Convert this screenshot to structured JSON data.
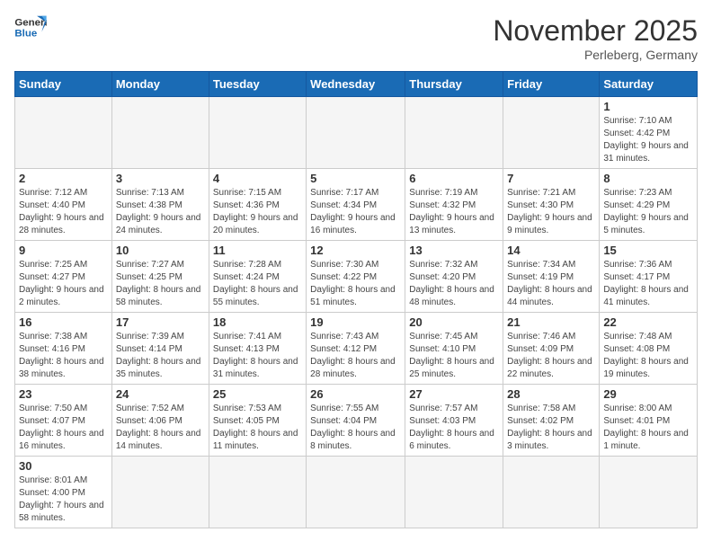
{
  "header": {
    "logo_general": "General",
    "logo_blue": "Blue",
    "month_title": "November 2025",
    "subtitle": "Perleberg, Germany"
  },
  "days_of_week": [
    "Sunday",
    "Monday",
    "Tuesday",
    "Wednesday",
    "Thursday",
    "Friday",
    "Saturday"
  ],
  "weeks": [
    [
      {
        "day": "",
        "info": ""
      },
      {
        "day": "",
        "info": ""
      },
      {
        "day": "",
        "info": ""
      },
      {
        "day": "",
        "info": ""
      },
      {
        "day": "",
        "info": ""
      },
      {
        "day": "",
        "info": ""
      },
      {
        "day": "1",
        "info": "Sunrise: 7:10 AM\nSunset: 4:42 PM\nDaylight: 9 hours\nand 31 minutes."
      }
    ],
    [
      {
        "day": "2",
        "info": "Sunrise: 7:12 AM\nSunset: 4:40 PM\nDaylight: 9 hours\nand 28 minutes."
      },
      {
        "day": "3",
        "info": "Sunrise: 7:13 AM\nSunset: 4:38 PM\nDaylight: 9 hours\nand 24 minutes."
      },
      {
        "day": "4",
        "info": "Sunrise: 7:15 AM\nSunset: 4:36 PM\nDaylight: 9 hours\nand 20 minutes."
      },
      {
        "day": "5",
        "info": "Sunrise: 7:17 AM\nSunset: 4:34 PM\nDaylight: 9 hours\nand 16 minutes."
      },
      {
        "day": "6",
        "info": "Sunrise: 7:19 AM\nSunset: 4:32 PM\nDaylight: 9 hours\nand 13 minutes."
      },
      {
        "day": "7",
        "info": "Sunrise: 7:21 AM\nSunset: 4:30 PM\nDaylight: 9 hours\nand 9 minutes."
      },
      {
        "day": "8",
        "info": "Sunrise: 7:23 AM\nSunset: 4:29 PM\nDaylight: 9 hours\nand 5 minutes."
      }
    ],
    [
      {
        "day": "9",
        "info": "Sunrise: 7:25 AM\nSunset: 4:27 PM\nDaylight: 9 hours\nand 2 minutes."
      },
      {
        "day": "10",
        "info": "Sunrise: 7:27 AM\nSunset: 4:25 PM\nDaylight: 8 hours\nand 58 minutes."
      },
      {
        "day": "11",
        "info": "Sunrise: 7:28 AM\nSunset: 4:24 PM\nDaylight: 8 hours\nand 55 minutes."
      },
      {
        "day": "12",
        "info": "Sunrise: 7:30 AM\nSunset: 4:22 PM\nDaylight: 8 hours\nand 51 minutes."
      },
      {
        "day": "13",
        "info": "Sunrise: 7:32 AM\nSunset: 4:20 PM\nDaylight: 8 hours\nand 48 minutes."
      },
      {
        "day": "14",
        "info": "Sunrise: 7:34 AM\nSunset: 4:19 PM\nDaylight: 8 hours\nand 44 minutes."
      },
      {
        "day": "15",
        "info": "Sunrise: 7:36 AM\nSunset: 4:17 PM\nDaylight: 8 hours\nand 41 minutes."
      }
    ],
    [
      {
        "day": "16",
        "info": "Sunrise: 7:38 AM\nSunset: 4:16 PM\nDaylight: 8 hours\nand 38 minutes."
      },
      {
        "day": "17",
        "info": "Sunrise: 7:39 AM\nSunset: 4:14 PM\nDaylight: 8 hours\nand 35 minutes."
      },
      {
        "day": "18",
        "info": "Sunrise: 7:41 AM\nSunset: 4:13 PM\nDaylight: 8 hours\nand 31 minutes."
      },
      {
        "day": "19",
        "info": "Sunrise: 7:43 AM\nSunset: 4:12 PM\nDaylight: 8 hours\nand 28 minutes."
      },
      {
        "day": "20",
        "info": "Sunrise: 7:45 AM\nSunset: 4:10 PM\nDaylight: 8 hours\nand 25 minutes."
      },
      {
        "day": "21",
        "info": "Sunrise: 7:46 AM\nSunset: 4:09 PM\nDaylight: 8 hours\nand 22 minutes."
      },
      {
        "day": "22",
        "info": "Sunrise: 7:48 AM\nSunset: 4:08 PM\nDaylight: 8 hours\nand 19 minutes."
      }
    ],
    [
      {
        "day": "23",
        "info": "Sunrise: 7:50 AM\nSunset: 4:07 PM\nDaylight: 8 hours\nand 16 minutes."
      },
      {
        "day": "24",
        "info": "Sunrise: 7:52 AM\nSunset: 4:06 PM\nDaylight: 8 hours\nand 14 minutes."
      },
      {
        "day": "25",
        "info": "Sunrise: 7:53 AM\nSunset: 4:05 PM\nDaylight: 8 hours\nand 11 minutes."
      },
      {
        "day": "26",
        "info": "Sunrise: 7:55 AM\nSunset: 4:04 PM\nDaylight: 8 hours\nand 8 minutes."
      },
      {
        "day": "27",
        "info": "Sunrise: 7:57 AM\nSunset: 4:03 PM\nDaylight: 8 hours\nand 6 minutes."
      },
      {
        "day": "28",
        "info": "Sunrise: 7:58 AM\nSunset: 4:02 PM\nDaylight: 8 hours\nand 3 minutes."
      },
      {
        "day": "29",
        "info": "Sunrise: 8:00 AM\nSunset: 4:01 PM\nDaylight: 8 hours\nand 1 minute."
      }
    ],
    [
      {
        "day": "30",
        "info": "Sunrise: 8:01 AM\nSunset: 4:00 PM\nDaylight: 7 hours\nand 58 minutes."
      },
      {
        "day": "",
        "info": ""
      },
      {
        "day": "",
        "info": ""
      },
      {
        "day": "",
        "info": ""
      },
      {
        "day": "",
        "info": ""
      },
      {
        "day": "",
        "info": ""
      },
      {
        "day": "",
        "info": ""
      }
    ]
  ]
}
